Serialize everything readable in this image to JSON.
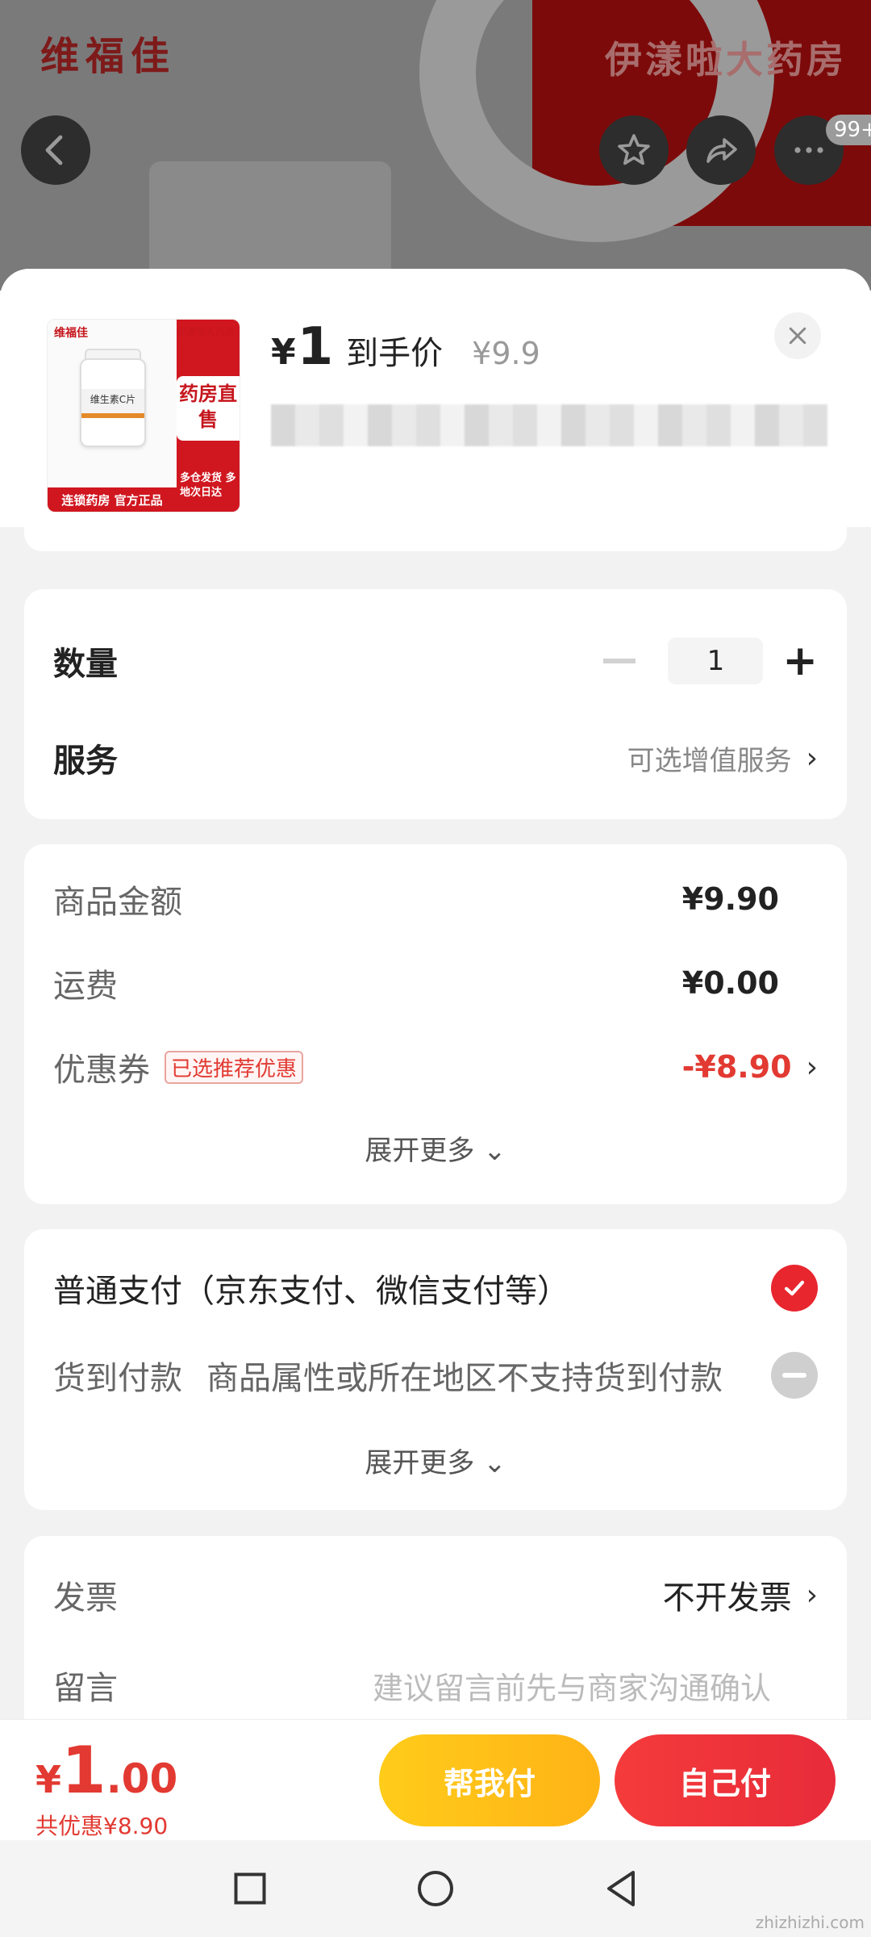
{
  "background": {
    "brand": "维福佳",
    "store": "伊漾啦大药房",
    "cart_badge": "99+"
  },
  "sheet": {
    "product": {
      "thumb_brand": "维福佳",
      "thumb_store": "伊漾啦大药房",
      "thumb_product": "维生素C片",
      "thumb_direct": "药房直售",
      "thumb_ship": "多仓发货 多地次日达",
      "thumb_bottom": "连锁药房 官方正品"
    },
    "price": {
      "symbol": "¥",
      "value": "1",
      "label": "到手价",
      "original": "¥9.9"
    },
    "quantity": {
      "label": "数量",
      "value": "1"
    },
    "service": {
      "label": "服务",
      "hint": "可选增值服务"
    },
    "costs": {
      "goods_label": "商品金额",
      "goods_value": "¥9.90",
      "shipping_label": "运费",
      "shipping_value": "¥0.00",
      "coupon_label": "优惠券",
      "coupon_tag": "已选推荐优惠",
      "coupon_value": "-¥8.90",
      "expand": "展开更多"
    },
    "payment": {
      "normal": "普通支付（京东支付、微信支付等）",
      "cod_label": "货到付款",
      "cod_note": "商品属性或所在地区不支持货到付款",
      "expand": "展开更多"
    },
    "invoice": {
      "label": "发票",
      "value": "不开发票"
    },
    "message": {
      "label": "留言",
      "placeholder": "建议留言前先与商家沟通确认"
    }
  },
  "footer": {
    "symbol": "¥",
    "total_int": "1",
    "total_dec": ".00",
    "saved": "共优惠¥8.90",
    "help_pay": "帮我付",
    "self_pay": "自己付"
  },
  "watermark": "zhizhizhi.com",
  "colors": {
    "accent_red": "#e23a32",
    "help_yellow": "#ffc21a",
    "pay_red": "#ee3339"
  }
}
